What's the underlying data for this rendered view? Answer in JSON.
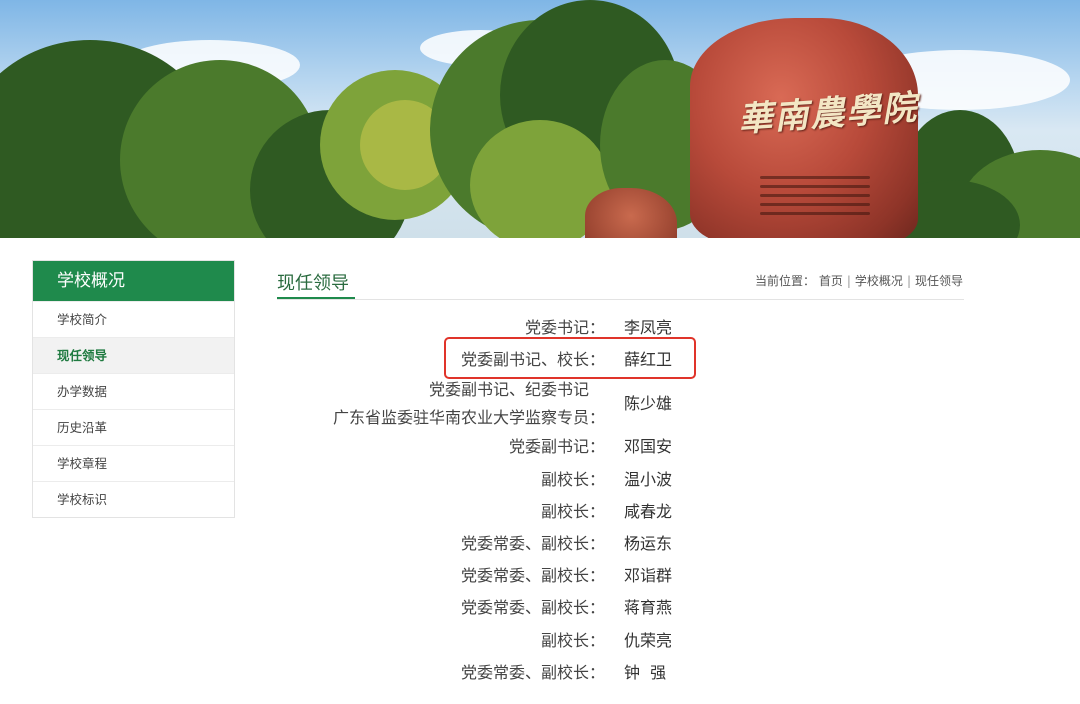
{
  "banner": {
    "rock_inscription": "華南農學院"
  },
  "sidebar": {
    "heading": "学校概况",
    "items": [
      {
        "label": "学校简介"
      },
      {
        "label": "现任领导"
      },
      {
        "label": "办学数据"
      },
      {
        "label": "历史沿革"
      },
      {
        "label": "学校章程"
      },
      {
        "label": "学校标识"
      }
    ],
    "active_item": "现任领导"
  },
  "main": {
    "title": "现任领导",
    "breadcrumb": {
      "prefix": "当前位置：",
      "items": [
        "首页",
        "学校概况",
        "现任领导"
      ]
    },
    "leaders": [
      {
        "role": "党委书记：",
        "name": "李凤亮"
      },
      {
        "role": "党委副书记、校长：",
        "name": "薛红卫"
      },
      {
        "role": "党委副书记、纪委书记",
        "role2": "广东省监委驻华南农业大学监察专员：",
        "name": "陈少雄"
      },
      {
        "role": "党委副书记：",
        "name": "邓国安"
      },
      {
        "role": "副校长：",
        "name": "温小波"
      },
      {
        "role": "副校长：",
        "name": "咸春龙"
      },
      {
        "role": "党委常委、副校长：",
        "name": "杨运东"
      },
      {
        "role": "党委常委、副校长：",
        "name": "邓诣群"
      },
      {
        "role": "党委常委、副校长：",
        "name": "蒋育燕"
      },
      {
        "role": "副校长：",
        "name": "仇荣亮"
      },
      {
        "role": "党委常委、副校长：",
        "name": "钟  强"
      }
    ]
  },
  "colors": {
    "brand_green": "#1f8a4c",
    "highlight_red": "#e0342a"
  }
}
